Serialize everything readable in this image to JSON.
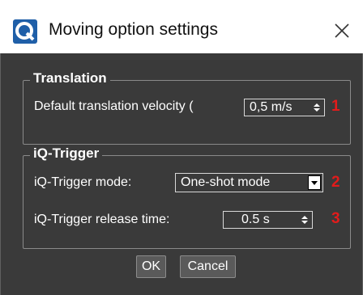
{
  "window": {
    "title": "Moving option settings"
  },
  "translation": {
    "group_title": "Translation",
    "velocity_label": "Default translation velocity (",
    "velocity_value": "0,5 m/s",
    "marker": "1"
  },
  "trigger": {
    "group_title": "iQ-Trigger",
    "mode_label": "iQ-Trigger mode:",
    "mode_value": "One-shot mode",
    "mode_marker": "2",
    "release_label": "iQ-Trigger release time:",
    "release_value": "0.5 s",
    "release_marker": "3"
  },
  "buttons": {
    "ok_label": "OK",
    "cancel_label": "Cancel"
  },
  "colors": {
    "panel_bg": "#3a3a3a",
    "marker": "#e21b1b",
    "app_icon": "#1f5fa8"
  },
  "icons": {
    "app": "app-logo-icon",
    "close": "close-icon",
    "spin": "spin-arrows-icon",
    "dropdown": "dropdown-arrow-icon"
  }
}
